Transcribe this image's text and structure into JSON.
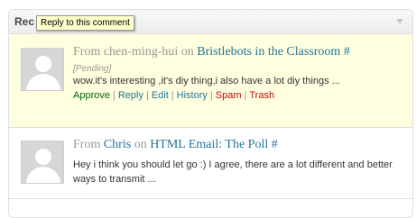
{
  "widget": {
    "title": "Rec"
  },
  "tooltip": {
    "text": "Reply to this comment"
  },
  "comments": [
    {
      "from_label": "From",
      "author": "chen-ming-hui",
      "on_label": "on",
      "post": "Bristlebots in the Classroom #",
      "status": "[Pending]",
      "excerpt": "wow.it's interesting ,it's diy thing,i also have a lot diy things ...",
      "actions": {
        "approve": "Approve",
        "reply": "Reply",
        "edit": "Edit",
        "history": "History",
        "spam": "Spam",
        "trash": "Trash",
        "separator": "|"
      }
    },
    {
      "from_label": "From",
      "author": "Chris",
      "on_label": "on",
      "post": "HTML Email: The Poll #",
      "excerpt": "Hey i think you should let go :) I agree, there are a lot different and better ways to transmit ..."
    }
  ],
  "colors": {
    "pending_background": "#ffffe0",
    "link": "#21759b",
    "approve": "#006505",
    "spam_trash": "#bc0b0b"
  }
}
